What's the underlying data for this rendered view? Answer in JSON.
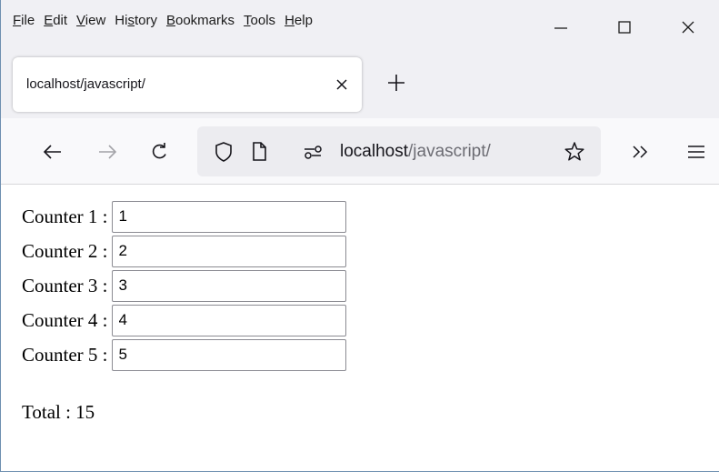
{
  "menubar": {
    "items": [
      {
        "label": "File",
        "accel": "F",
        "rest": "ile"
      },
      {
        "label": "Edit",
        "accel": "E",
        "rest": "dit"
      },
      {
        "label": "View",
        "accel": "V",
        "rest": "iew"
      },
      {
        "label": "History",
        "pre": "Hi",
        "accel": "s",
        "rest": "tory"
      },
      {
        "label": "Bookmarks",
        "accel": "B",
        "rest": "ookmarks"
      },
      {
        "label": "Tools",
        "accel": "T",
        "rest": "ools"
      },
      {
        "label": "Help",
        "accel": "H",
        "rest": "elp"
      }
    ]
  },
  "window_controls": [
    "minimize-icon",
    "maximize-icon",
    "close-icon"
  ],
  "tab": {
    "title": "localhost/javascript/"
  },
  "urlbar": {
    "host": "localhost",
    "path": "/javascript/"
  },
  "colors": {
    "chrome_bg": "#f0f0f4",
    "toolbar_bg": "#f9f9fb",
    "urlbar_bg": "#ececf0",
    "window_border": "#6e8fb0"
  },
  "page": {
    "counters": [
      {
        "label": "Counter 1 :",
        "value": "1"
      },
      {
        "label": "Counter 2 :",
        "value": "2"
      },
      {
        "label": "Counter 3 :",
        "value": "3"
      },
      {
        "label": "Counter 4 :",
        "value": "4"
      },
      {
        "label": "Counter 5 :",
        "value": "5"
      }
    ],
    "total_label": "Total : 15"
  }
}
